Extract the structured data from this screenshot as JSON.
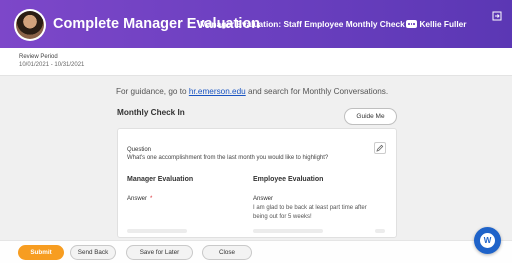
{
  "header": {
    "title": "Complete Manager Evaluation",
    "subtitle": "Manager Evaluation: Staff Employee Monthly Check In: Kellie Fuller",
    "more_icon": "ellipsis-icon",
    "exit_icon": "exit-icon",
    "accent_color": "#6a3fbf"
  },
  "review": {
    "label": "Review Period",
    "value": "10/01/2021 - 10/31/2021"
  },
  "guidance": {
    "prefix": "For guidance, go to ",
    "link": "hr.emerson.edu",
    "suffix": " and search for Monthly Conversations."
  },
  "section": {
    "title": "Monthly Check In",
    "guide_button": "Guide Me"
  },
  "card": {
    "question_label": "Question",
    "question_text": "What's one accomplishment from the last month you would like to highlight?",
    "edit_icon": "pencil-icon",
    "col_manager": "Manager Evaluation",
    "col_employee": "Employee Evaluation",
    "manager_answer_label": "Answer",
    "required_mark": "*",
    "employee_answer_label": "Answer",
    "employee_answer_text": "I am glad to be back at least part time after being out for 5 weeks!"
  },
  "footer": {
    "submit": "Submit",
    "send_back": "Send Back",
    "save_for_later": "Save for Later",
    "close": "Close",
    "submit_color": "#f79d21"
  },
  "help": {
    "icon": "help-assistant-icon",
    "glyph": "W"
  }
}
